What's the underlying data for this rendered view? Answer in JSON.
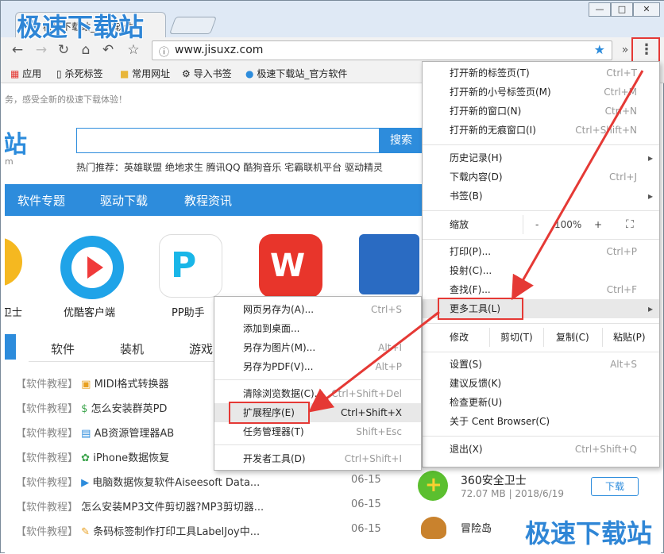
{
  "window": {
    "tab_title": "极速下载站_官方软件",
    "min": "—",
    "max": "□",
    "close": "✕"
  },
  "toolbar": {
    "url": "www.jisuxz.com"
  },
  "bookmarks": [
    "应用",
    "杀死标签",
    "常用网址",
    "导入书签",
    "极速下载站_官方软件"
  ],
  "page": {
    "notice": "务，感受全新的极速下载体验！",
    "logo_char": "站",
    "logo_sub": "m",
    "search_button": "搜索",
    "hot": "热门推荐：英雄联盟  绝地求生  腾讯QQ  酷狗音乐  宅霸联机平台  驱动精灵",
    "nav": [
      "软件专题",
      "驱动下载",
      "教程资讯"
    ],
    "apps": [
      "卫士",
      "优酷客户端",
      "PP助手"
    ],
    "cat_tabs": [
      "软件",
      "装机",
      "游戏"
    ],
    "rows": [
      {
        "tag": "【软件教程】",
        "title": "MIDI格式转换器",
        "date": ""
      },
      {
        "tag": "【软件教程】",
        "title": "怎么安装群英PD",
        "date": ""
      },
      {
        "tag": "【软件教程】",
        "title": "AB资源管理器AB",
        "date": ""
      },
      {
        "tag": "【软件教程】",
        "title": "iPhone数据恢复",
        "date": ""
      },
      {
        "tag": "【软件教程】",
        "title": "电脑数据恢复软件Aiseesoft Data...",
        "date": "06-15"
      },
      {
        "tag": "【软件教程】",
        "title": "怎么安装MP3文件剪切器?MP3剪切器...",
        "date": "06-15"
      },
      {
        "tag": "【软件教程】",
        "title": "条码标签制作打印工具LabelJoy中...",
        "date": "06-15"
      }
    ]
  },
  "menu": {
    "items": [
      {
        "label": "打开新的标签页(T)",
        "shortcut": "Ctrl+T"
      },
      {
        "label": "打开新的小号标签页(M)",
        "shortcut": "Ctrl+M"
      },
      {
        "label": "打开新的窗口(N)",
        "shortcut": "Ctrl+N"
      },
      {
        "label": "打开新的无痕窗口(I)",
        "shortcut": "Ctrl+Shift+N"
      },
      {
        "label": "历史记录(H)",
        "shortcut": ""
      },
      {
        "label": "下载内容(D)",
        "shortcut": "Ctrl+J"
      },
      {
        "label": "书签(B)",
        "shortcut": ""
      },
      {
        "label": "打印(P)...",
        "shortcut": "Ctrl+P"
      },
      {
        "label": "投射(C)...",
        "shortcut": ""
      },
      {
        "label": "查找(F)...",
        "shortcut": "Ctrl+F"
      },
      {
        "label": "更多工具(L)",
        "shortcut": ""
      },
      {
        "label": "设置(S)",
        "shortcut": "Alt+S"
      },
      {
        "label": "建议反馈(K)",
        "shortcut": ""
      },
      {
        "label": "检查更新(U)",
        "shortcut": ""
      },
      {
        "label": "关于 Cent Browser(C)",
        "shortcut": ""
      },
      {
        "label": "退出(X)",
        "shortcut": "Ctrl+Shift+Q"
      }
    ],
    "zoom_label": "缩放",
    "zoom_minus": "-",
    "zoom_value": "100%",
    "zoom_plus": "+",
    "edit_label": "修改",
    "cut": "剪切(T)",
    "copy": "复制(C)",
    "paste": "粘贴(P)"
  },
  "submenu": {
    "items": [
      {
        "label": "网页另存为(A)...",
        "shortcut": "Ctrl+S"
      },
      {
        "label": "添加到桌面...",
        "shortcut": ""
      },
      {
        "label": "另存为图片(M)...",
        "shortcut": "Alt+I"
      },
      {
        "label": "另存为PDF(V)...",
        "shortcut": "Alt+P"
      },
      {
        "label": "清除浏览数据(C)...",
        "shortcut": "Ctrl+Shift+Del"
      },
      {
        "label": "扩展程序(E)",
        "shortcut": "Ctrl+Shift+X"
      },
      {
        "label": "任务管理器(T)",
        "shortcut": "Shift+Esc"
      },
      {
        "label": "开发者工具(D)",
        "shortcut": "Ctrl+Shift+I"
      }
    ]
  },
  "side": {
    "app1_name": "360安全卫士",
    "app1_meta": "72.07 MB | 2018/6/19",
    "download": "下载",
    "app2_name": "冒险岛"
  },
  "watermark": "极速下载站",
  "colors": {
    "accent": "#2d8cdc",
    "highlight_box": "#e53935"
  }
}
